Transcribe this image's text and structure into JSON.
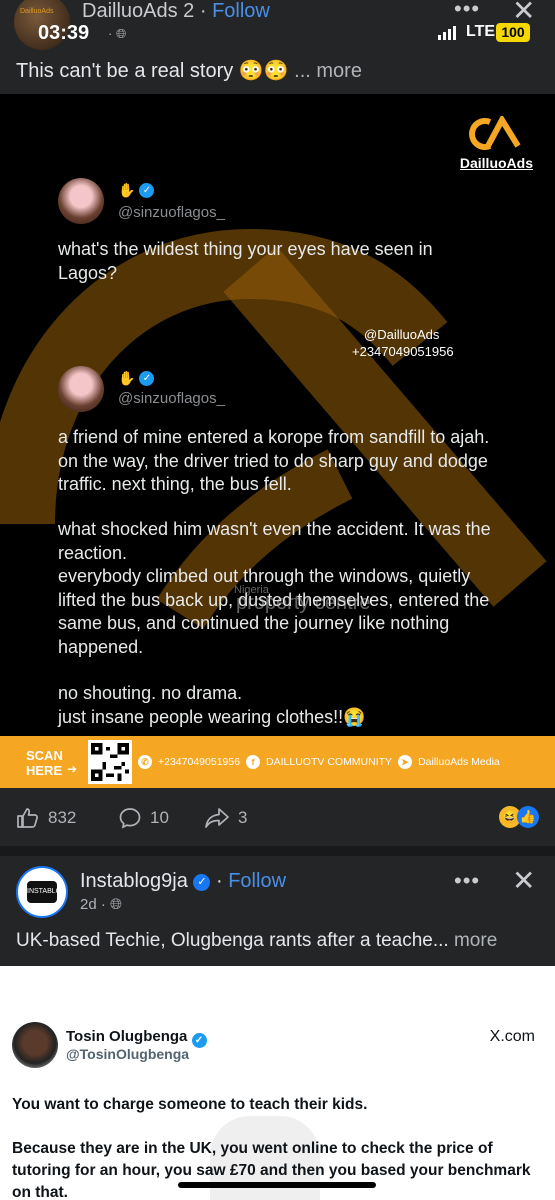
{
  "post1": {
    "page_name": "DailluoAds 2",
    "separator": " · ",
    "follow_label": "Follow",
    "avatar_mini_text": "DailluoAds",
    "caption": "This can't be a real story 😳😳",
    "more_label": "... more"
  },
  "status_bar": {
    "time": "03:39",
    "network": "LTE",
    "battery": "100"
  },
  "post_image": {
    "brand": "DailluoAds",
    "tweet1": {
      "handle": "@sinzuoflagos_",
      "text": "what's the wildest thing your eyes have seen in Lagos?"
    },
    "contact": {
      "handle": "@DailluoAds",
      "phone": "+2347049051956"
    },
    "tweet2": {
      "handle": "@sinzuoflagos_",
      "paragraphs": [
        "a friend of mine entered a korope from sandfill to ajah. on the way, the driver tried to do sharp guy and dodge traffic. next thing, the bus fell.",
        "what shocked him wasn't even the accident. It was the reaction.\neverybody climbed out through the windows, quietly lifted the bus back up, dusted themselves, entered the same bus, and continued the journey like nothing happened.",
        "no shouting. no drama.\njust insane people wearing clothes!!😭"
      ]
    },
    "watermark": {
      "small": "Nigeria",
      "large": "property centre"
    }
  },
  "banner": {
    "scan_label": "SCAN\nHERE",
    "whatsapp": "+2347049051956",
    "facebook": "DAILLUOTV COMMUNITY",
    "telegram": "DailluoAds Media"
  },
  "reactions": {
    "likes": "832",
    "comments": "10",
    "shares": "3"
  },
  "post2": {
    "page_name": "Instablog9ja",
    "follow_label": "Follow",
    "meta": "2d · ",
    "caption": "UK-based Techie, Olugbenga rants after a teache...",
    "more_label": " more",
    "avatar_text": "INSTABLOG"
  },
  "embedded_tweet": {
    "name": "Tosin Olugbenga",
    "handle": "@TosinOlugbenga",
    "source": "X.com",
    "line1": "You want to charge someone to teach their kids.",
    "line2": "Because they are in the UK, you went online to check the price of tutoring for an hour, you saw £70 and then you based your benchmark on that."
  },
  "colors": {
    "accent_orange": "#f5a623",
    "facebook_blue": "#1877f2",
    "follow_blue": "#4a8fe7"
  }
}
